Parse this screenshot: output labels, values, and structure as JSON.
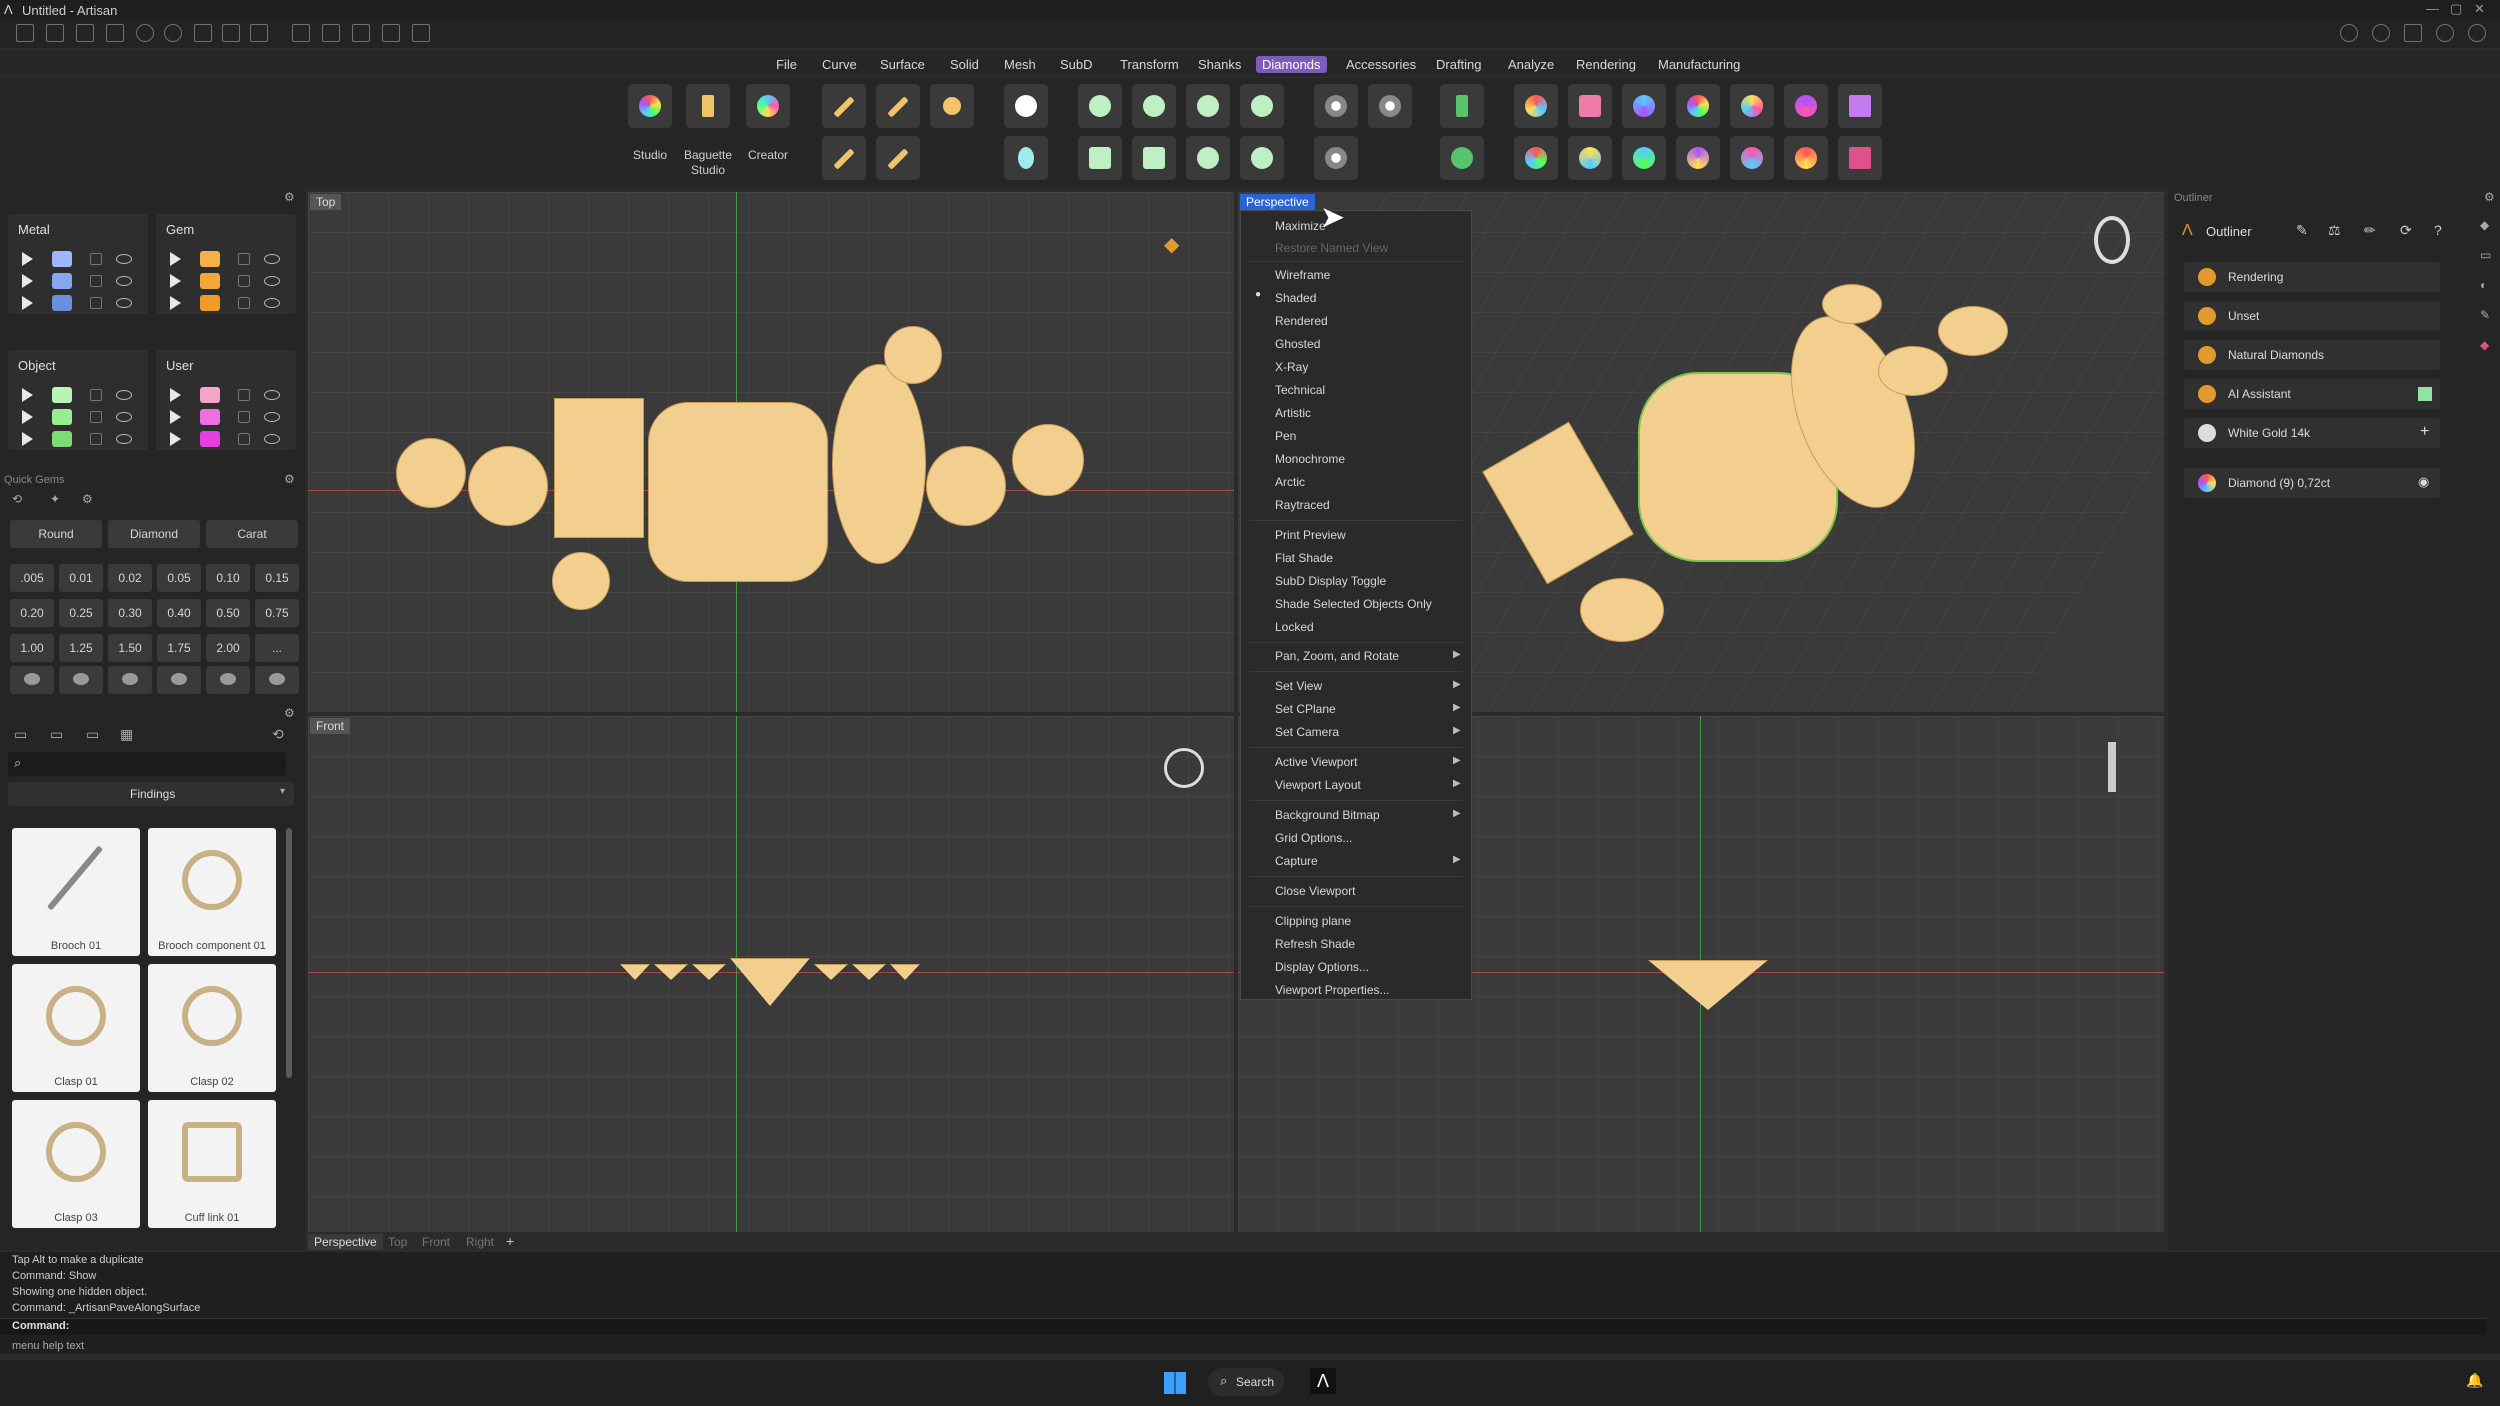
{
  "app": {
    "title": "Untitled - Artisan"
  },
  "menubar": [
    "File",
    "Curve",
    "Surface",
    "Solid",
    "Mesh",
    "SubD",
    "Transform",
    "Shanks",
    "Diamonds",
    "Accessories",
    "Drafting",
    "Analyze",
    "Rendering",
    "Manufacturing"
  ],
  "menubar_active": "Diamonds",
  "ribbon": {
    "studio": "Studio",
    "baguette": "Baguette",
    "baguette2": "Studio",
    "creator": "Creator"
  },
  "layers": {
    "metal": "Metal",
    "gem": "Gem",
    "object": "Object",
    "user": "User",
    "metal_colors": [
      "#9fb6ff",
      "#86a6f0",
      "#6b8ee0"
    ],
    "gem_colors": [
      "#f4b14a",
      "#f3a73a",
      "#f09a2a"
    ],
    "object_colors": [
      "#b9f4b4",
      "#98ee8f",
      "#7fdc74"
    ],
    "user_colors": [
      "#f5a6c8",
      "#ee6fe0",
      "#e33fe0"
    ]
  },
  "quickgems": {
    "title": "Quick Gems",
    "round": "Round",
    "diamond": "Diamond",
    "carat": "Carat",
    "values": [
      ".005",
      "0.01",
      "0.02",
      "0.05",
      "0.10",
      "0.15",
      "0.20",
      "0.25",
      "0.30",
      "0.40",
      "0.50",
      "0.75",
      "1.00",
      "1.25",
      "1.50",
      "1.75",
      "2.00",
      "..."
    ]
  },
  "library": {
    "findings": "Findings",
    "items": [
      "Brooch 01",
      "Brooch component 01",
      "Clasp 01",
      "Clasp 02",
      "Clasp 03",
      "Cuff link 01"
    ]
  },
  "viewports": {
    "top": "Top",
    "perspective": "Perspective",
    "front": "Front"
  },
  "context_menu": {
    "maximize": "Maximize",
    "restore": "Restore Named View",
    "wireframe": "Wireframe",
    "shaded": "Shaded",
    "rendered": "Rendered",
    "ghosted": "Ghosted",
    "xray": "X-Ray",
    "technical": "Technical",
    "artistic": "Artistic",
    "pen": "Pen",
    "monochrome": "Monochrome",
    "arctic": "Arctic",
    "raytraced": "Raytraced",
    "print": "Print Preview",
    "flat": "Flat Shade",
    "subd": "SubD Display Toggle",
    "shadesel": "Shade Selected Objects Only",
    "locked": "Locked",
    "pan": "Pan, Zoom, and Rotate",
    "setview": "Set View",
    "setcplane": "Set CPlane",
    "setcamera": "Set Camera",
    "active": "Active Viewport",
    "layout": "Viewport Layout",
    "bitmap": "Background Bitmap",
    "grid": "Grid Options...",
    "capture": "Capture",
    "close": "Close Viewport",
    "clipping": "Clipping plane",
    "refresh": "Refresh Shade",
    "display": "Display Options...",
    "props": "Viewport Properties..."
  },
  "outliner": {
    "panel": "Outliner",
    "title": "Outliner",
    "rendering": "Rendering",
    "unset": "Unset",
    "natural": "Natural Diamonds",
    "ai": "AI Assistant",
    "whitegold": "White Gold 14k",
    "diamond": "Diamond (9) 0,72ct"
  },
  "vptabs": [
    "Perspective",
    "Top",
    "Front",
    "Right"
  ],
  "command": {
    "lines": [
      "Tap Alt to make a duplicate",
      "Command: Show",
      "Showing one hidden object.",
      "Command: _ArtisanPaveAlongSurface"
    ],
    "prompt": "Command:",
    "help": "menu help text"
  },
  "taskbar": {
    "search": "Search"
  }
}
